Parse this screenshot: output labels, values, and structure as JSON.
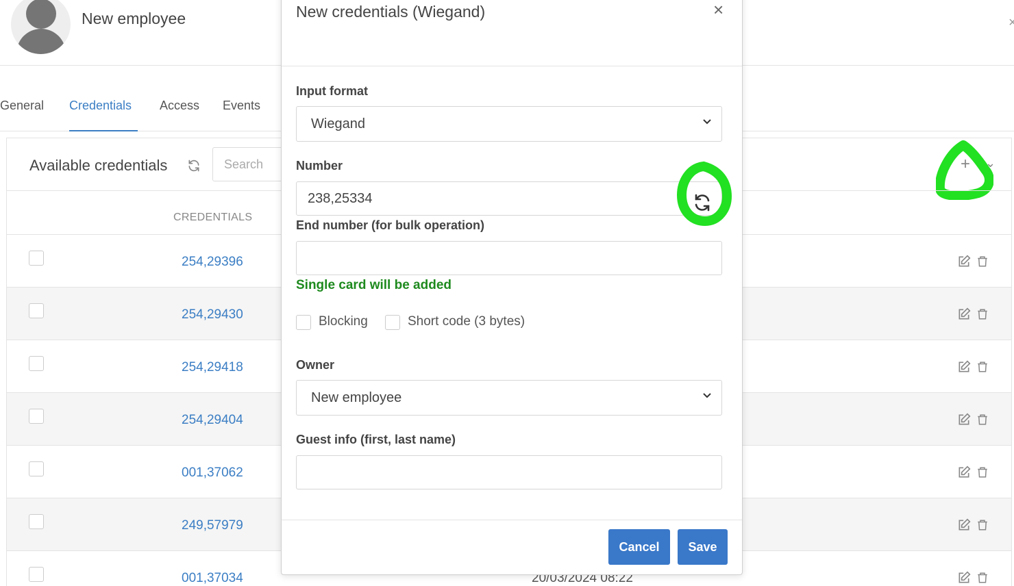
{
  "employee": {
    "name": "New employee"
  },
  "tabs": [
    {
      "label": "General"
    },
    {
      "label": "Credentials"
    },
    {
      "label": "Access"
    },
    {
      "label": "Events"
    }
  ],
  "panel": {
    "title": "Available credentials",
    "search_placeholder": "Search",
    "column_credentials": "CREDENTIALS",
    "rows": [
      {
        "number": "254,29396"
      },
      {
        "number": "254,29430"
      },
      {
        "number": "254,29418"
      },
      {
        "number": "254,29404"
      },
      {
        "number": "001,37062"
      },
      {
        "number": "249,57979"
      },
      {
        "number": "001,37034",
        "date": "20/03/2024 08:22"
      }
    ]
  },
  "modal": {
    "title": "New credentials (Wiegand)",
    "input_format_label": "Input format",
    "input_format_value": "Wiegand",
    "number_label": "Number",
    "number_value": "238,25334",
    "end_number_label": "End number (for bulk operation)",
    "end_number_value": "",
    "hint": "Single card will be added",
    "blocking_label": "Blocking",
    "short_code_label": "Short code (3 bytes)",
    "owner_label": "Owner",
    "owner_value": "New employee",
    "guest_info_label": "Guest info (first, last name)",
    "guest_info_value": "",
    "cancel_label": "Cancel",
    "save_label": "Save"
  },
  "colors": {
    "accent": "#3b7ec4",
    "button": "#3a78c9",
    "hint_green": "#1e8a1e",
    "highlight_marker": "#22e022"
  },
  "icons": [
    "close-icon",
    "refresh-icon",
    "chevron-down-icon",
    "plus-icon",
    "edit-icon",
    "trash-icon",
    "avatar-icon"
  ]
}
